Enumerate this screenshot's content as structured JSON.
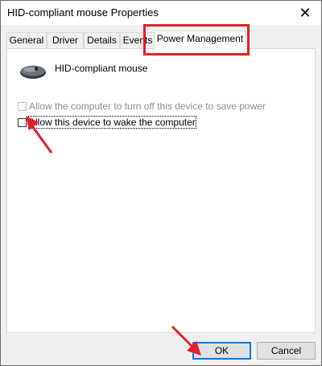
{
  "window": {
    "title": "HID-compliant mouse Properties",
    "close_glyph": "✕"
  },
  "tabs": [
    {
      "label": "General"
    },
    {
      "label": "Driver"
    },
    {
      "label": "Details"
    },
    {
      "label": "Events"
    },
    {
      "label": "Power Management",
      "active": true
    }
  ],
  "device": {
    "name": "HID-compliant mouse",
    "icon": "mouse-icon"
  },
  "options": {
    "turn_off": {
      "label": "Allow the computer to turn off this device to save power",
      "checked": false,
      "enabled": false
    },
    "wake": {
      "label": "Allow this device to wake the computer",
      "checked": false,
      "enabled": true
    }
  },
  "buttons": {
    "ok": "OK",
    "cancel": "Cancel"
  },
  "colors": {
    "annotation": "#e3202a",
    "default_button_border": "#0078d7"
  }
}
